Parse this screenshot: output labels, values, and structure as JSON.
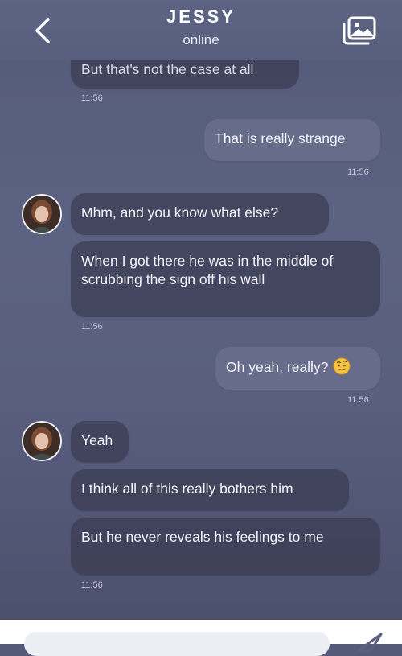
{
  "header": {
    "contact_name": "JESSY",
    "contact_status": "online"
  },
  "messages": [
    {
      "from": "contact",
      "text": "But that's not the case at all",
      "time": "11:56"
    },
    {
      "from": "me",
      "text": "That is really strange",
      "time": "11:56"
    },
    {
      "from": "contact",
      "text": "Mhm, and you know what else?"
    },
    {
      "from": "contact",
      "text": "When I got there he was in the middle of scrubbing the sign off his wall",
      "time": "11:56"
    },
    {
      "from": "me",
      "text": "Oh yeah, really?",
      "emoji": "raised-eyebrow-emoji",
      "time": "11:56"
    },
    {
      "from": "contact",
      "text": "Yeah"
    },
    {
      "from": "contact",
      "text": "I think all of this really bothers him"
    },
    {
      "from": "contact",
      "text": "But he never reveals his feelings to me",
      "time": "11:56"
    }
  ],
  "icons": {
    "back": "chevron-left-icon",
    "gallery": "image-gallery-icon",
    "send": "send-arrow-icon"
  }
}
